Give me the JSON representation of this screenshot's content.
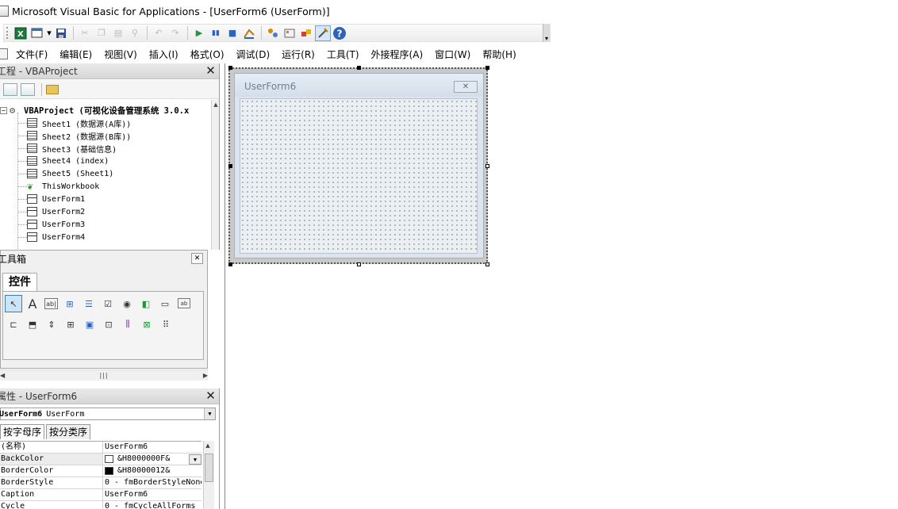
{
  "window": {
    "title": "Microsoft Visual Basic for Applications - [UserForm6 (UserForm)]"
  },
  "toolbar": {
    "icons": [
      "excel-icon",
      "insert-userform-icon",
      "save-icon",
      "cut-icon",
      "copy-icon",
      "paste-icon",
      "find-icon",
      "undo-icon",
      "redo-icon",
      "run-icon",
      "break-icon",
      "reset-icon",
      "design-mode-icon",
      "project-explorer-icon",
      "properties-window-icon",
      "object-browser-icon",
      "toolbox-icon",
      "help-icon"
    ]
  },
  "menu": {
    "items": [
      "文件(F)",
      "编辑(E)",
      "视图(V)",
      "插入(I)",
      "格式(O)",
      "调试(D)",
      "运行(R)",
      "工具(T)",
      "外接程序(A)",
      "窗口(W)",
      "帮助(H)"
    ]
  },
  "project": {
    "title": "工程 - VBAProject",
    "root": "VBAProject (可视化设备管理系统 3.0.x",
    "items": [
      {
        "label": "Sheet1 (数据源(A库))",
        "type": "sheet"
      },
      {
        "label": "Sheet2 (数据源(B库))",
        "type": "sheet"
      },
      {
        "label": "Sheet3 (基础信息)",
        "type": "sheet"
      },
      {
        "label": "Sheet4 (index)",
        "type": "sheet"
      },
      {
        "label": "Sheet5 (Sheet1)",
        "type": "sheet"
      },
      {
        "label": "ThisWorkbook",
        "type": "workbook"
      },
      {
        "label": "UserForm1",
        "type": "form"
      },
      {
        "label": "UserForm2",
        "type": "form"
      },
      {
        "label": "UserForm3",
        "type": "form"
      },
      {
        "label": "UserForm4",
        "type": "form"
      }
    ]
  },
  "toolbox": {
    "title": "工具箱",
    "tab": "控件",
    "row1": [
      "A",
      "ab|",
      "⊞",
      "☰",
      "☑",
      "◉",
      "◧",
      "▭",
      "ab"
    ],
    "row2": [
      "⊏",
      "⬒",
      "⇕",
      "⊞",
      "▣",
      "⊡",
      "⫼",
      "⊠",
      "⠿"
    ]
  },
  "properties": {
    "title": "属性 - UserForm6",
    "object_name": "UserForm6",
    "object_type": "UserForm",
    "tabs": [
      "按字母序",
      "按分类序"
    ],
    "rows": [
      {
        "name": "(名称)",
        "value": "UserForm6"
      },
      {
        "name": "BackColor",
        "value": "&H8000000F&",
        "swatch": "#ffffff"
      },
      {
        "name": "BorderColor",
        "value": "&H80000012&",
        "swatch": "#000000"
      },
      {
        "name": "BorderStyle",
        "value": "0 - fmBorderStyleNone"
      },
      {
        "name": "Caption",
        "value": "UserForm6"
      },
      {
        "name": "Cycle",
        "value": "0 - fmCycleAllForms"
      }
    ]
  },
  "designer": {
    "form_caption": "UserForm6"
  }
}
